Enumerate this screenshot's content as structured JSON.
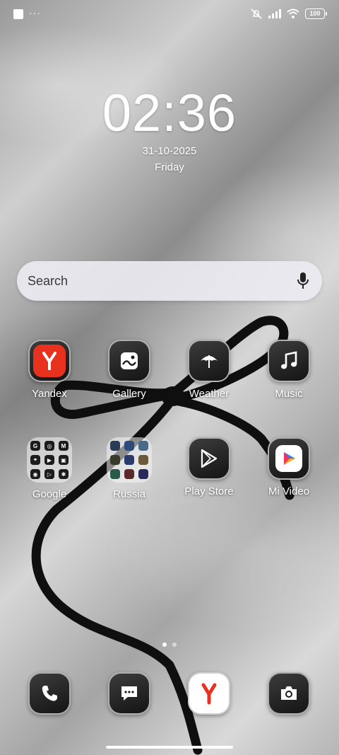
{
  "status_bar": {
    "more_indicator": "···",
    "battery": "100",
    "icons": [
      "notification-square-icon",
      "alarm-off-icon",
      "cellular-signal-icon",
      "wifi-icon",
      "battery-icon"
    ]
  },
  "lockclock": {
    "time": "02:36",
    "date": "31-10-2025",
    "day": "Friday"
  },
  "search": {
    "label": "Search",
    "icon": "mic-icon"
  },
  "apps": [
    {
      "label": "Yandex",
      "icon": "yandex-icon",
      "accent": "#e8321e"
    },
    {
      "label": "Gallery",
      "icon": "gallery-icon"
    },
    {
      "label": "Weather",
      "icon": "weather-umbrella-icon"
    },
    {
      "label": "Music",
      "icon": "music-note-icon"
    },
    {
      "label": "Google",
      "icon": "folder-icon"
    },
    {
      "label": "Russia",
      "icon": "folder-icon"
    },
    {
      "label": "Play Store",
      "icon": "play-store-icon"
    },
    {
      "label": "Mi Video",
      "icon": "mi-video-icon"
    }
  ],
  "google_folder": [
    "G",
    "◎",
    "M",
    "⌖",
    "▶",
    "▣",
    "◉",
    "▷",
    "✱"
  ],
  "pages": {
    "count": 2,
    "current": 1
  },
  "dock": [
    {
      "name": "Phone",
      "icon": "phone-icon"
    },
    {
      "name": "Messages",
      "icon": "message-icon"
    },
    {
      "name": "Yandex Browser",
      "icon": "yandex-icon"
    },
    {
      "name": "Camera",
      "icon": "camera-icon"
    }
  ],
  "colors": {
    "yandex_red": "#e8321e",
    "icon_border": "#c8c8c8"
  }
}
